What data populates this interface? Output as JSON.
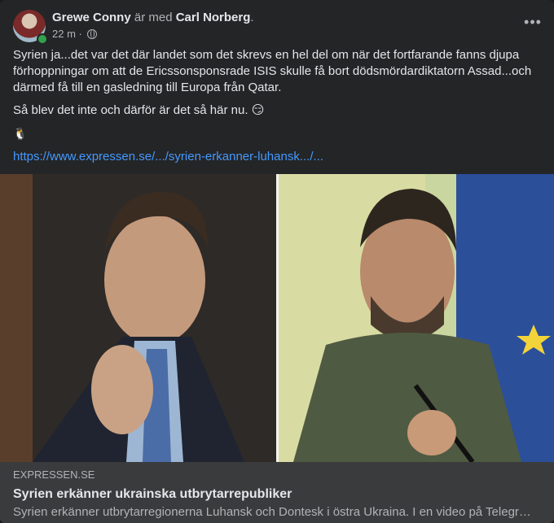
{
  "post": {
    "author": "Grewe Conny",
    "with_text": "är med",
    "tagged": "Carl Norberg",
    "period": ".",
    "timestamp": "22 m",
    "separator": "·",
    "more_label": "•••"
  },
  "body": {
    "paragraph1": "Syrien ja...det var det där landet som det skrevs en hel del om när det fortfarande fanns djupa förhoppningar om att de Ericssonsponsrade ISIS skulle få bort dödsmördardiktatorn Assad...och därmed få till en gasledning till Europa från Qatar.",
    "paragraph2": "Så blev det inte och därför är det så här nu.",
    "emoji": "😏",
    "penguin": "🐧",
    "link_text": "https://www.expressen.se/.../syrien-erkanner-luhansk.../..."
  },
  "preview": {
    "domain": "EXPRESSEN.SE",
    "headline": "Syrien erkänner ukrainska utbrytarrepubliker",
    "description": "Syrien erkänner utbrytarregionerna Luhansk och Dontesk i östra Ukraina. I en video på Telegr…"
  },
  "colors": {
    "background": "#242526",
    "link": "#4599ff",
    "preview_bg": "#3a3b3c",
    "online": "#31a24c"
  }
}
